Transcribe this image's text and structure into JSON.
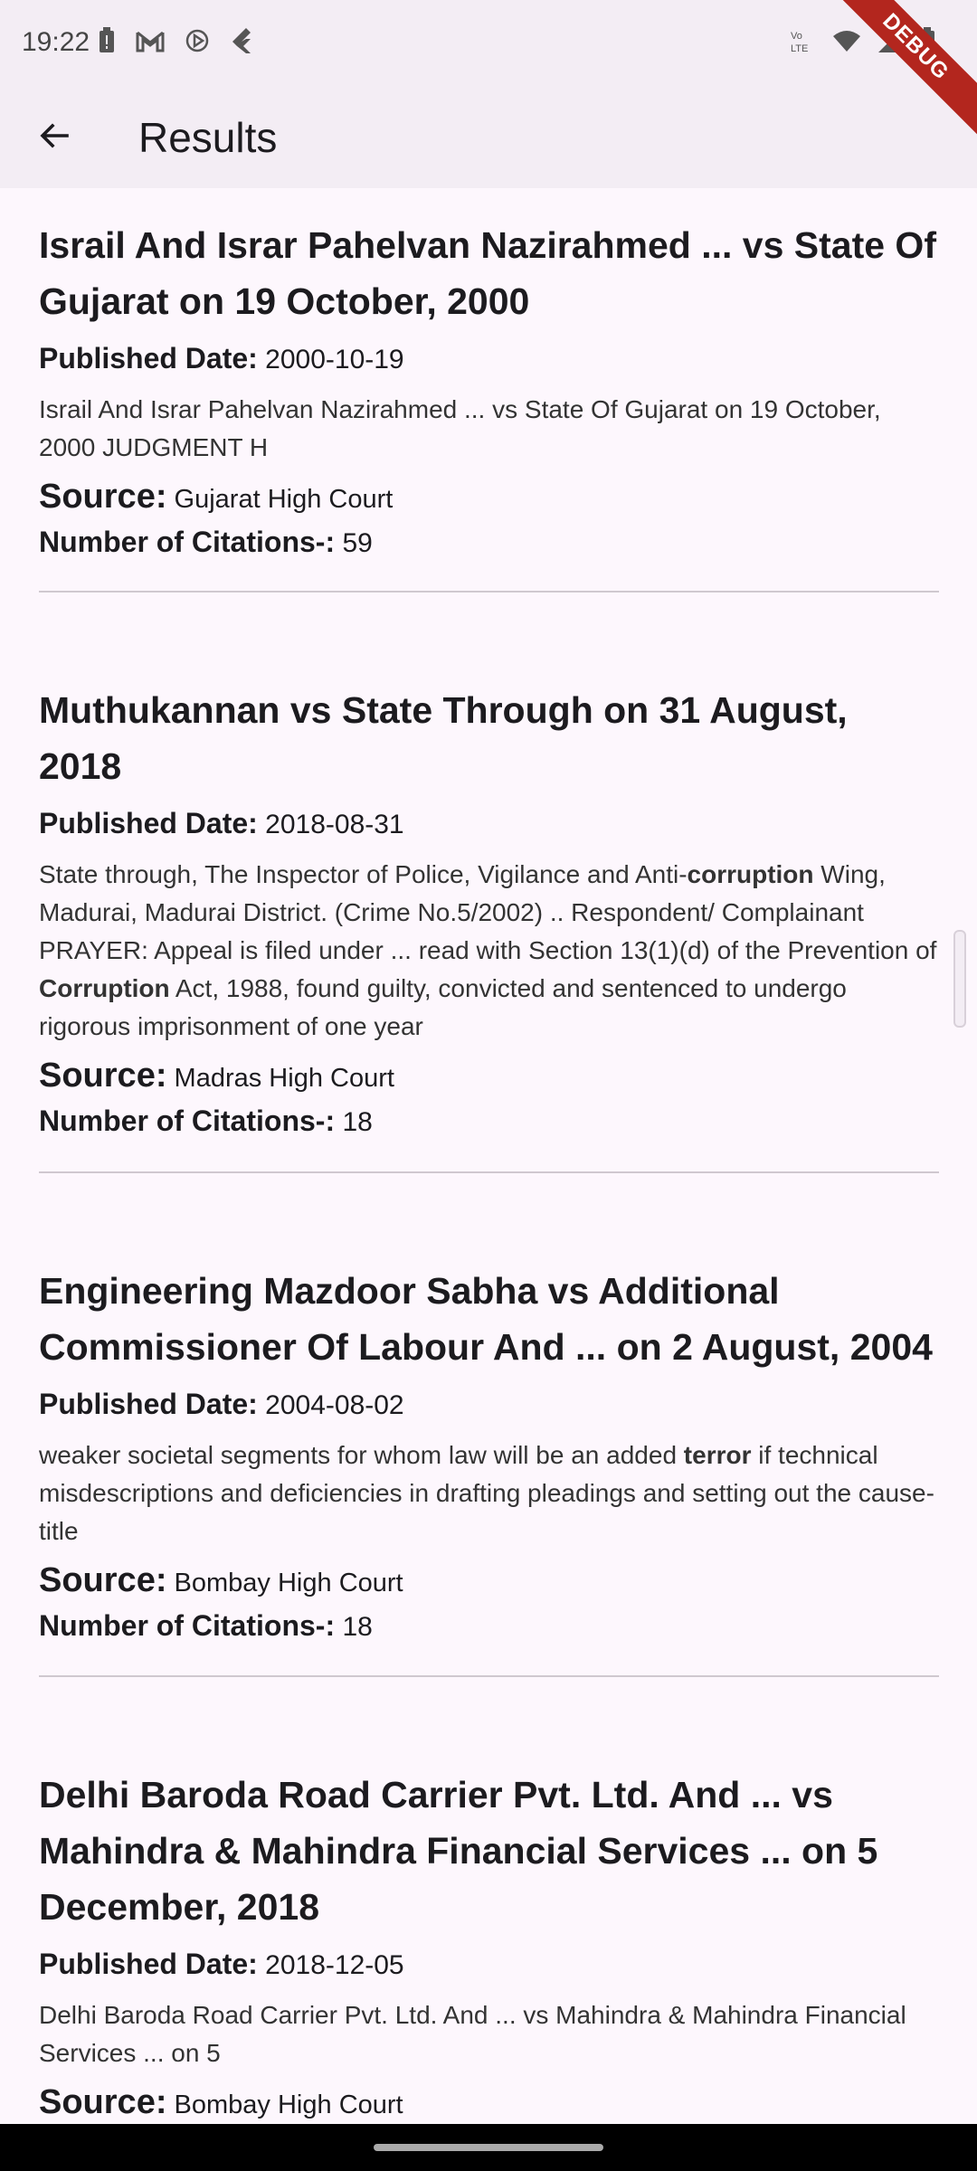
{
  "status_bar": {
    "time": "19:22",
    "left_icons": [
      "battery-alert-icon",
      "gmail-icon",
      "play-icon",
      "flutter-icon"
    ],
    "right_icons": [
      "volte-icon",
      "wifi-icon",
      "signal-icon",
      "battery-icon"
    ]
  },
  "app_bar": {
    "title": "Results",
    "back_icon": "arrow-left-icon",
    "debug_banner": "DEBUG"
  },
  "labels": {
    "published_date": "Published Date:",
    "source": "Source:",
    "citations": "Number of Citations-:"
  },
  "results": [
    {
      "title": "Israil And Israr Pahelvan Nazirahmed ... vs State Of Gujarat on 19 October, 2000",
      "published_date": "2000-10-19",
      "snippet": [
        {
          "t": "Israil And Israr Pahelvan Nazirahmed ... vs State Of Gujarat on 19 October, 2000 JUDGMENT H",
          "b": false
        }
      ],
      "source": "Gujarat High Court",
      "citations": "59"
    },
    {
      "title": "Muthukannan vs State Through on 31 August, 2018",
      "published_date": "2018-08-31",
      "snippet": [
        {
          "t": "State through, The Inspector of Police, Vigilance and Anti-",
          "b": false
        },
        {
          "t": "corruption",
          "b": true
        },
        {
          "t": " Wing, Madurai, Madurai District. (Crime No.5/2002) .. Respondent/ Complainant PRAYER: Appeal is filed under ... read with Section 13(1)(d) of the Prevention of ",
          "b": false
        },
        {
          "t": "Corruption",
          "b": true
        },
        {
          "t": " Act, 1988, found guilty, convicted and sentenced to undergo rigorous imprisonment of one year",
          "b": false
        }
      ],
      "source": "Madras High Court",
      "citations": "18"
    },
    {
      "title": "Engineering Mazdoor Sabha vs Additional Commissioner Of Labour And ... on 2 August, 2004",
      "published_date": "2004-08-02",
      "snippet": [
        {
          "t": "weaker societal segments for whom law will be an added ",
          "b": false
        },
        {
          "t": "terror",
          "b": true
        },
        {
          "t": " if technical misdescriptions and deficiencies in drafting pleadings and setting out the cause-title",
          "b": false
        }
      ],
      "source": "Bombay High Court",
      "citations": "18"
    },
    {
      "title": "Delhi Baroda Road Carrier Pvt. Ltd. And ... vs Mahindra & Mahindra Financial Services ... on 5 December, 2018",
      "published_date": "2018-12-05",
      "snippet": [
        {
          "t": "Delhi Baroda Road Carrier Pvt. Ltd. And ... vs Mahindra & Mahindra Financial Services ... on 5",
          "b": false
        }
      ],
      "source": "Bombay High Court",
      "citations": ""
    }
  ]
}
